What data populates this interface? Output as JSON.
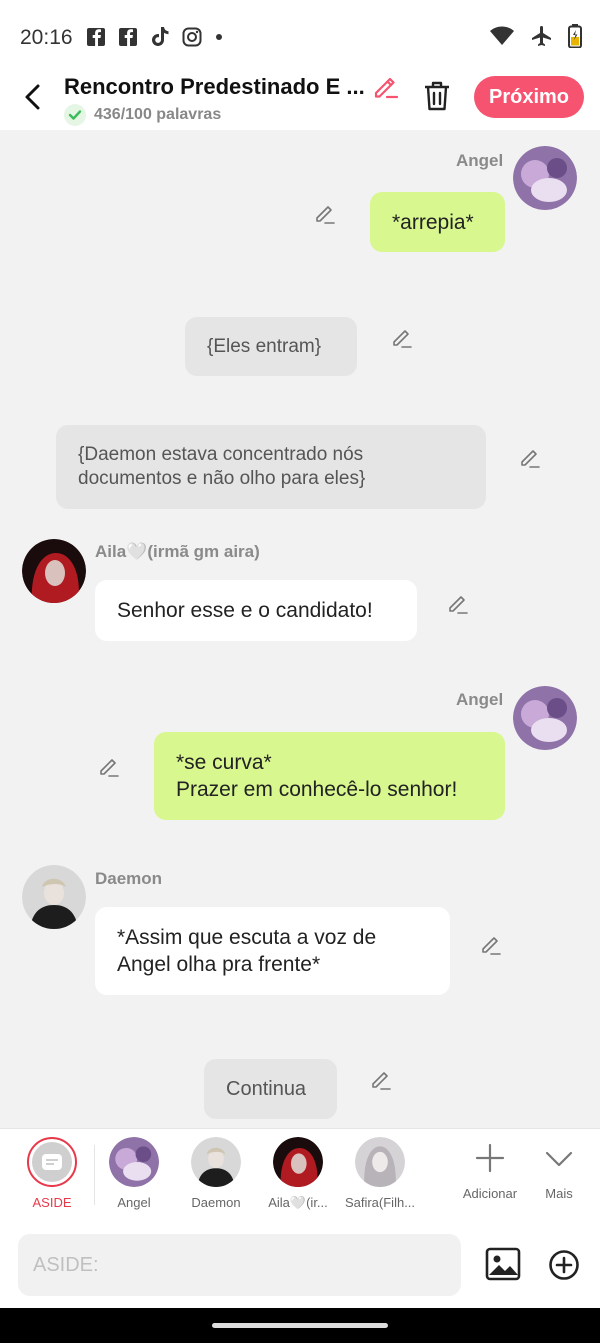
{
  "status": {
    "time": "20:16",
    "icons": [
      "facebook-icon",
      "facebook-icon",
      "tiktok-icon",
      "instagram-icon",
      "dot-icon"
    ],
    "right_icons": [
      "wifi-icon",
      "airplane-icon",
      "battery-icon"
    ]
  },
  "header": {
    "title": "Rencontro Predestinado E ...",
    "word_count": "436/100 palavras",
    "next_label": "Próximo"
  },
  "messages": [
    {
      "type": "right",
      "name": "Angel",
      "text": "*arrepia*"
    },
    {
      "type": "aside",
      "text": "{Eles entram}"
    },
    {
      "type": "aside",
      "text": "{Daemon estava concentrado nós documentos e não olho para eles}"
    },
    {
      "type": "left",
      "name": "Aila🤍(irmã gm aira)",
      "text": "Senhor esse e o candidato!"
    },
    {
      "type": "right",
      "name": "Angel",
      "text": "*se curva*\nPrazer em conhecê-lo senhor!"
    },
    {
      "type": "left",
      "name": "Daemon",
      "text": "*Assim que escuta a voz de Angel olha pra frente*"
    },
    {
      "type": "aside",
      "text": "Continua"
    }
  ],
  "characters": [
    {
      "label": "ASIDE"
    },
    {
      "label": "Angel"
    },
    {
      "label": "Daemon"
    },
    {
      "label": "Aila🤍(ir..."
    },
    {
      "label": "Safira(Filh..."
    }
  ],
  "actions": {
    "add_label": "Adicionar",
    "more_label": "Mais"
  },
  "input": {
    "placeholder": "ASIDE:"
  },
  "colors": {
    "accent": "#f5536f",
    "green_bubble": "#d8f78f",
    "aside_red": "#e8394b"
  }
}
